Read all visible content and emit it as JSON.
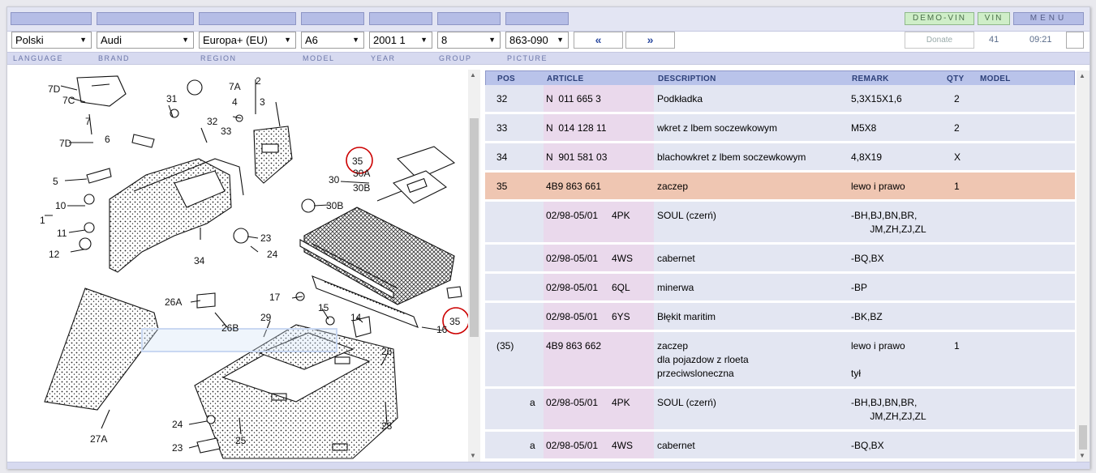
{
  "header": {
    "buttons": {
      "demo_vin": "DEMO-VIN",
      "vin": "VIN",
      "menu": "MENU"
    }
  },
  "selectors": {
    "language": "Polski",
    "brand": "Audi",
    "region": "Europa+ (EU)",
    "model": "A6",
    "year": "2001  1",
    "group": "8",
    "picture": "863-090"
  },
  "nav": {
    "prev": "«",
    "next": "»",
    "donate": "Donate",
    "count": "41",
    "time": "09:21"
  },
  "labels": [
    "LANGUAGE",
    "BRAND",
    "REGION",
    "MODEL",
    "YEAR",
    "GROUP",
    "PICTURE"
  ],
  "diagram": {
    "callouts": [
      "7D",
      "7C",
      "7",
      "31",
      "7A",
      "2",
      "4",
      "3",
      "32",
      "33",
      "7D",
      "6",
      "5",
      "10",
      "1",
      "11",
      "12",
      "34",
      "30",
      "35",
      "30A",
      "30B",
      "30B",
      "23",
      "24",
      "17",
      "26A",
      "26B",
      "29",
      "15",
      "14",
      "16",
      "35",
      "26",
      "27A",
      "24",
      "23",
      "25",
      "28"
    ]
  },
  "table": {
    "columns": {
      "pos": "POS",
      "article": "ARTICLE",
      "description": "DESCRIPTION",
      "remark": "REMARK",
      "qty": "QTY",
      "model": "MODEL"
    },
    "rows": [
      {
        "pos": "32",
        "sub": "",
        "article": "N  011 665 3",
        "code": "",
        "description": "Podkładka",
        "remark": "5,3X15X1,6",
        "qty": "2",
        "highlight": false
      },
      {
        "pos": "33",
        "sub": "",
        "article": "N  014 128 11",
        "code": "",
        "description": "wkret z lbem soczewkowym",
        "remark": "M5X8",
        "qty": "2",
        "highlight": false
      },
      {
        "pos": "34",
        "sub": "",
        "article": "N  901 581 03",
        "code": "",
        "description": "blachowkret z lbem soczewkowym",
        "remark": "4,8X19",
        "qty": "X",
        "highlight": false
      },
      {
        "pos": "35",
        "sub": "",
        "article": "4B9 863 661",
        "code": "",
        "description": "zaczep",
        "remark": "lewo i prawo",
        "qty": "1",
        "highlight": true
      },
      {
        "pos": "",
        "sub": "",
        "article": "02/98-05/01",
        "code": "4PK",
        "description": "SOUL (czerń)",
        "remark": "-BH,BJ,BN,BR,\n       JM,ZH,ZJ,ZL",
        "qty": "",
        "highlight": false
      },
      {
        "pos": "",
        "sub": "",
        "article": "02/98-05/01",
        "code": "4WS",
        "description": "cabernet",
        "remark": "-BQ,BX",
        "qty": "",
        "highlight": false
      },
      {
        "pos": "",
        "sub": "",
        "article": "02/98-05/01",
        "code": "6QL",
        "description": "minerwa",
        "remark": "-BP",
        "qty": "",
        "highlight": false
      },
      {
        "pos": "",
        "sub": "",
        "article": "02/98-05/01",
        "code": "6YS",
        "description": "Błękit maritim",
        "remark": "-BK,BZ",
        "qty": "",
        "highlight": false
      },
      {
        "pos": "(35)",
        "sub": "",
        "article": "4B9 863 662",
        "code": "",
        "description": "zaczep\ndla pojazdow z rloeta\nprzeciwsloneczna",
        "remark": "lewo i prawo\n\ntył",
        "qty": "1",
        "highlight": false
      },
      {
        "pos": "",
        "sub": "a",
        "article": "02/98-05/01",
        "code": "4PK",
        "description": "SOUL (czerń)",
        "remark": "-BH,BJ,BN,BR,\n       JM,ZH,ZJ,ZL",
        "qty": "",
        "highlight": false
      },
      {
        "pos": "",
        "sub": "a",
        "article": "02/98-05/01",
        "code": "4WS",
        "description": "cabernet",
        "remark": "-BQ,BX",
        "qty": "",
        "highlight": false
      }
    ]
  }
}
